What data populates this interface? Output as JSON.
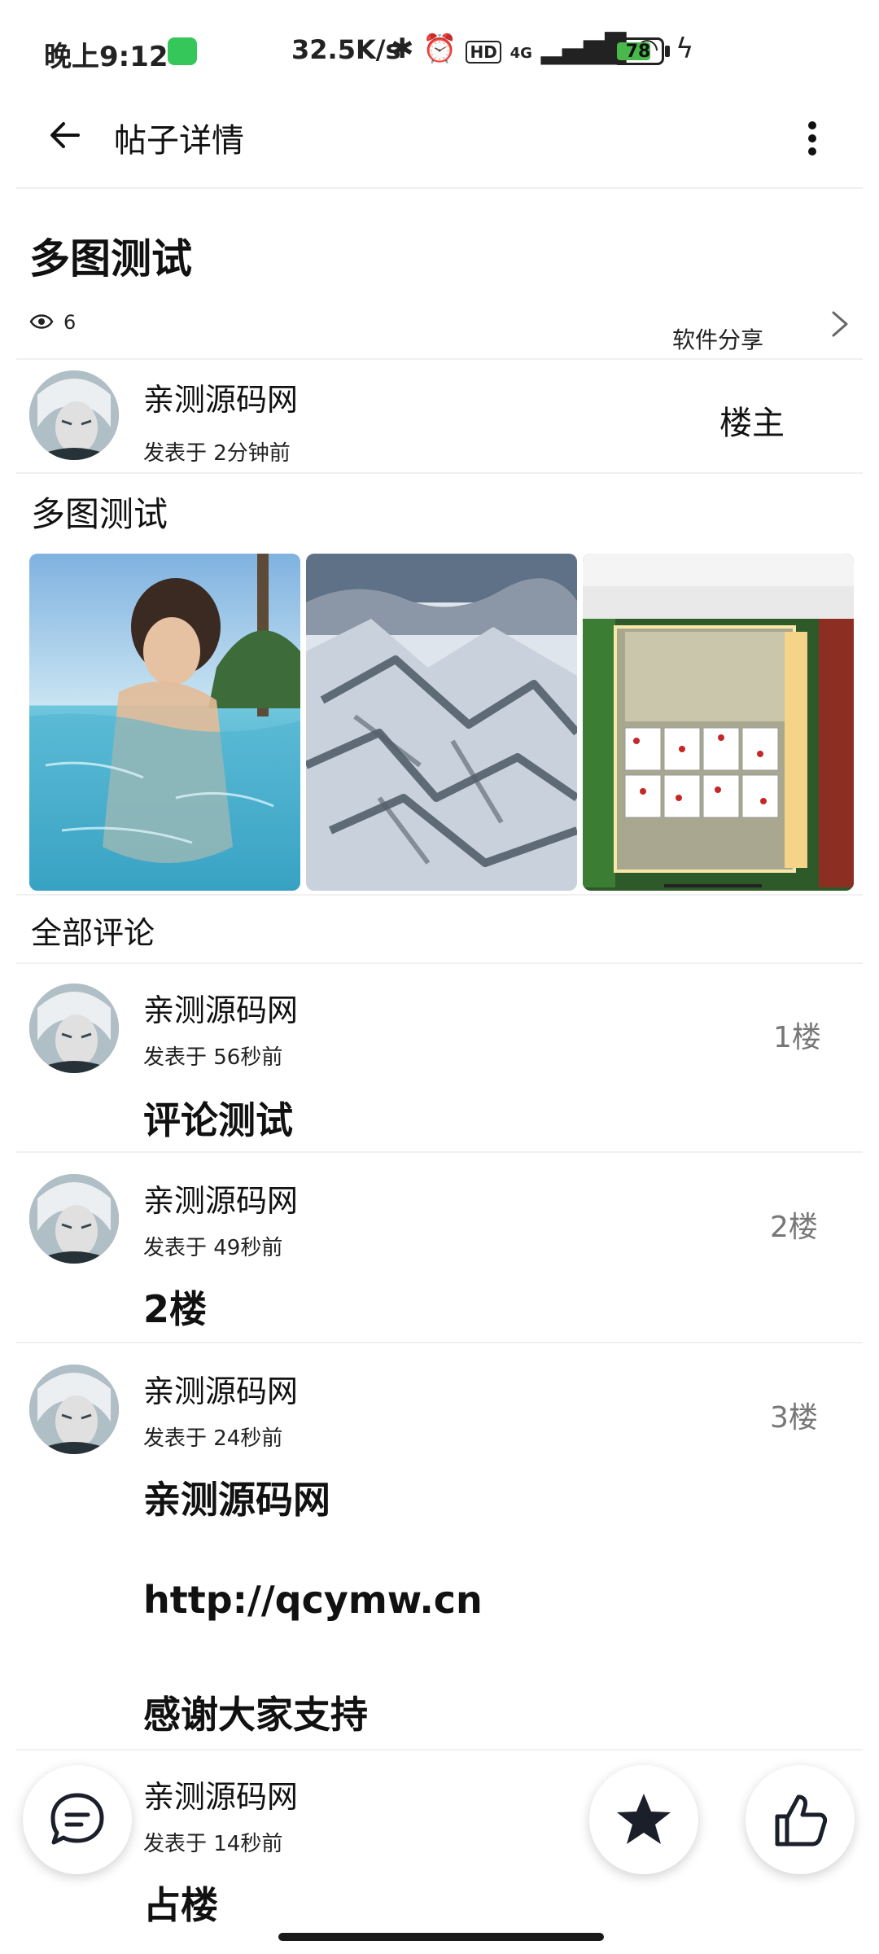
{
  "status_bar": {
    "time": "晚上9:12",
    "speed": "32.5K/s",
    "battery": "78",
    "battery_level": 0.78,
    "network": "4G",
    "hd": "HD"
  },
  "app_bar": {
    "title": "帖子详情"
  },
  "post": {
    "title": "多图测试",
    "views": "6",
    "category": "软件分享",
    "author": "亲测源码网",
    "time": "发表于 2分钟前",
    "owner_label": "楼主",
    "body": "多图测试"
  },
  "comments_header": "全部评论",
  "comments": [
    {
      "author": "亲测源码网",
      "time": "发表于 56秒前",
      "floor": "1楼",
      "text": "评论测试"
    },
    {
      "author": "亲测源码网",
      "time": "发表于 49秒前",
      "floor": "2楼",
      "text": "2楼"
    },
    {
      "author": "亲测源码网",
      "time": "发表于 24秒前",
      "floor": "3楼",
      "lines": [
        "亲测源码网",
        "http://qcymw.cn",
        "感谢大家支持"
      ]
    },
    {
      "author": "亲测源码网",
      "time": "发表于 14秒前",
      "text": "占楼"
    }
  ],
  "icons": {
    "back": "arrow-left-icon",
    "more": "more-vertical-icon",
    "eye": "eye-icon",
    "chevron": "chevron-right-icon",
    "comment": "comment-icon",
    "star": "star-icon",
    "like": "thumb-up-icon"
  }
}
